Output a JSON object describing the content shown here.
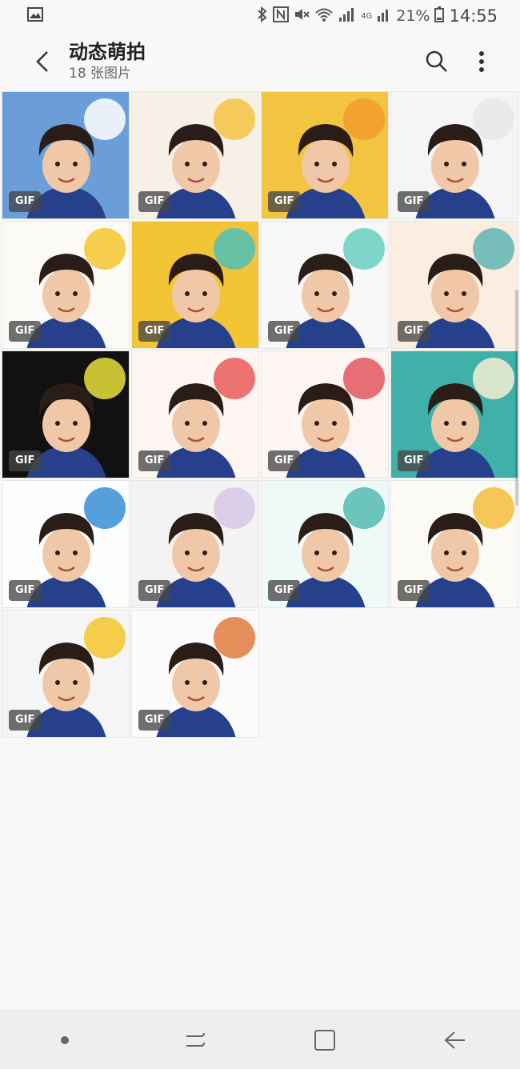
{
  "status_bar": {
    "battery": "21%",
    "time": "14:55",
    "network": "4G",
    "icons": [
      "gallery-icon",
      "bluetooth-icon",
      "nfc-icon",
      "mute-icon",
      "wifi-icon",
      "signal-icon",
      "battery-icon"
    ]
  },
  "header": {
    "title": "动态萌拍",
    "subtitle": "18 张图片"
  },
  "badge_label": "GIF",
  "items": [
    {
      "bg": "#6b9dd9",
      "accent": "#ffffff"
    },
    {
      "bg": "#f6f0e6",
      "accent": "#f5c242"
    },
    {
      "bg": "#f3c43f",
      "accent": "#f19c2e"
    },
    {
      "bg": "#f5f5f5",
      "accent": "#e8e8e8"
    },
    {
      "bg": "#fbfaf6",
      "accent": "#f6c430"
    },
    {
      "bg": "#f4c437",
      "accent": "#4fc1b7"
    },
    {
      "bg": "#f8f8f8",
      "accent": "#6bcfc2"
    },
    {
      "bg": "#fbeee0",
      "accent": "#5fb5b4"
    },
    {
      "bg": "#111111",
      "accent": "#e8e03a"
    },
    {
      "bg": "#fdf6f2",
      "accent": "#ea5c5c"
    },
    {
      "bg": "#fdf4f4",
      "accent": "#e4565e"
    },
    {
      "bg": "#40b1a8",
      "accent": "#f6f0d2"
    },
    {
      "bg": "#fbfdff",
      "accent": "#3a8ed3"
    },
    {
      "bg": "#f3f3f3",
      "accent": "#d6c7e6"
    },
    {
      "bg": "#eefaf8",
      "accent": "#53bbb2"
    },
    {
      "bg": "#fcfaf4",
      "accent": "#f2bd3b"
    },
    {
      "bg": "#f5f5f5",
      "accent": "#f4c52b"
    },
    {
      "bg": "#fbfbfb",
      "accent": "#e07a3c"
    }
  ],
  "nav": {
    "icons": [
      "dot-icon",
      "recents-icon",
      "home-icon",
      "back-arrow-icon"
    ]
  }
}
